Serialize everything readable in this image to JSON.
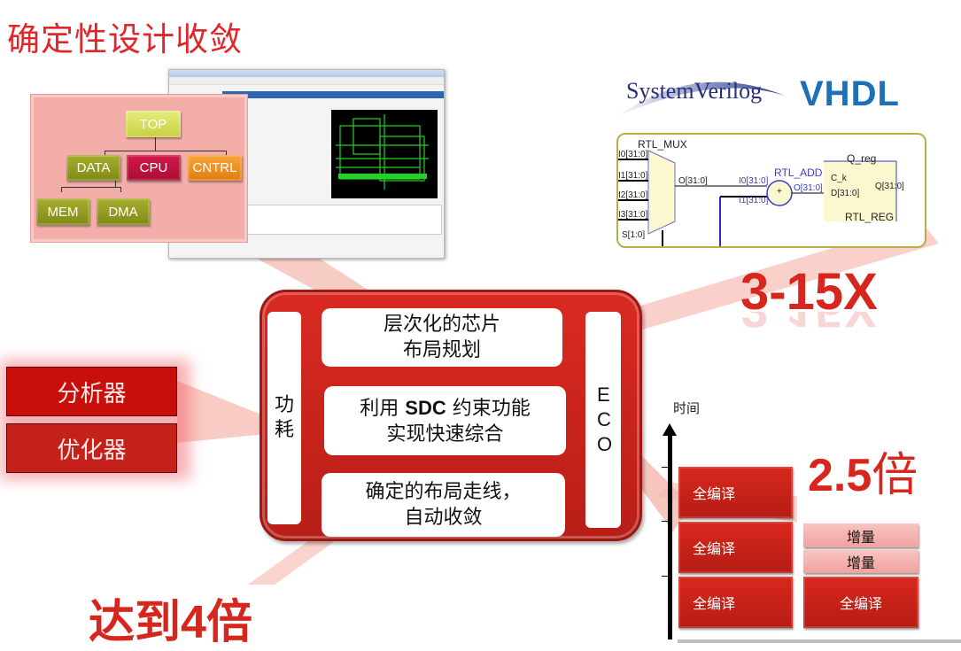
{
  "title": "确定性设计收敛",
  "hierarchy": {
    "top": "TOP",
    "level2": [
      "DATA",
      "CPU",
      "CNTRL"
    ],
    "level3": [
      "MEM",
      "DMA"
    ]
  },
  "logos": {
    "systemverilog": "SystemVerilog",
    "vhdl": "VHDL"
  },
  "schematic": {
    "mux_label": "RTL_MUX",
    "mux_inputs": [
      "I0[31:0]",
      "I1[31:0]",
      "I2[31:0]",
      "I3[31:0]"
    ],
    "mux_select": "S[1:0]",
    "mux_output": "O[31:0]",
    "adder_label": "RTL_ADD",
    "adder_inputs": [
      "I0[31:0]",
      "I1[31:0]"
    ],
    "adder_output": "O[31:0]",
    "adder_symbol": "+",
    "reg_name": "Q_reg",
    "reg_clk": "C_k",
    "reg_d": "D[31:0]",
    "reg_q": "Q[31:0]",
    "reg_type": "RTL_REG"
  },
  "speedup_synthesis": "3-15X",
  "center": {
    "left_bar": "功耗",
    "right_bar": "ECO",
    "box1": [
      "层次化的芯片",
      "布局规划"
    ],
    "box2_prefix": "利用 ",
    "box2_bold": "SDC",
    "box2_suffix": " 约束功能",
    "box2_line2": "实现快速综合",
    "box3": [
      "确定的布局走线，",
      "自动收敛"
    ]
  },
  "tools": [
    "分析器",
    "优化器"
  ],
  "time_chart": {
    "axis_label": "时间",
    "left_stack": [
      "全编译",
      "全编译",
      "全编译"
    ],
    "right_stack": [
      "增量",
      "增量",
      "全编译"
    ],
    "speedup": "2.5",
    "speedup_suffix": "倍"
  },
  "speedup_pnr": "达到",
  "speedup_pnr_num": "4",
  "speedup_pnr_suffix": "倍",
  "colors": {
    "accent_red": "#d7261e",
    "title_red": "#e0262a",
    "pink": "#f3aeaa"
  }
}
